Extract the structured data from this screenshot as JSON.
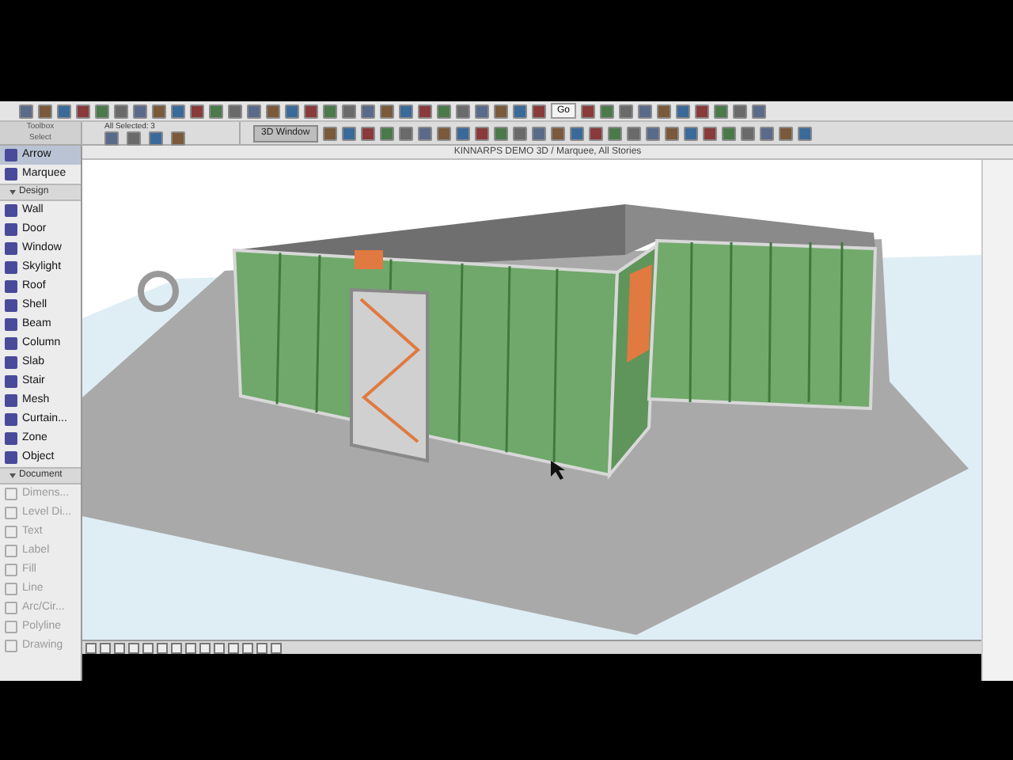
{
  "toolbar": {
    "go_label": "Go"
  },
  "info_box": {
    "selection": "All Selected: 3",
    "view_button": "3D Window"
  },
  "toolbox": {
    "title": "Toolbox",
    "select_label": "Select",
    "entries": [
      {
        "kind": "tool",
        "label": "Arrow",
        "selected": true,
        "disabled": false
      },
      {
        "kind": "tool",
        "label": "Marquee",
        "selected": false,
        "disabled": false
      },
      {
        "kind": "header",
        "label": "Design",
        "expanded": true
      },
      {
        "kind": "tool",
        "label": "Wall",
        "selected": false,
        "disabled": false
      },
      {
        "kind": "tool",
        "label": "Door",
        "selected": false,
        "disabled": false
      },
      {
        "kind": "tool",
        "label": "Window",
        "selected": false,
        "disabled": false
      },
      {
        "kind": "tool",
        "label": "Skylight",
        "selected": false,
        "disabled": false
      },
      {
        "kind": "tool",
        "label": "Roof",
        "selected": false,
        "disabled": false
      },
      {
        "kind": "tool",
        "label": "Shell",
        "selected": false,
        "disabled": false
      },
      {
        "kind": "tool",
        "label": "Beam",
        "selected": false,
        "disabled": false
      },
      {
        "kind": "tool",
        "label": "Column",
        "selected": false,
        "disabled": false
      },
      {
        "kind": "tool",
        "label": "Slab",
        "selected": false,
        "disabled": false
      },
      {
        "kind": "tool",
        "label": "Stair",
        "selected": false,
        "disabled": false
      },
      {
        "kind": "tool",
        "label": "Mesh",
        "selected": false,
        "disabled": false
      },
      {
        "kind": "tool",
        "label": "Curtain...",
        "selected": false,
        "disabled": false
      },
      {
        "kind": "tool",
        "label": "Zone",
        "selected": false,
        "disabled": false
      },
      {
        "kind": "tool",
        "label": "Object",
        "selected": false,
        "disabled": false
      },
      {
        "kind": "header",
        "label": "Document",
        "expanded": true
      },
      {
        "kind": "tool",
        "label": "Dimens...",
        "selected": false,
        "disabled": true
      },
      {
        "kind": "tool",
        "label": "Level Di...",
        "selected": false,
        "disabled": true
      },
      {
        "kind": "tool",
        "label": "Text",
        "selected": false,
        "disabled": true
      },
      {
        "kind": "tool",
        "label": "Label",
        "selected": false,
        "disabled": true
      },
      {
        "kind": "tool",
        "label": "Fill",
        "selected": false,
        "disabled": true
      },
      {
        "kind": "tool",
        "label": "Line",
        "selected": false,
        "disabled": true
      },
      {
        "kind": "tool",
        "label": "Arc/Cir...",
        "selected": false,
        "disabled": true
      },
      {
        "kind": "tool",
        "label": "Polyline",
        "selected": false,
        "disabled": true
      },
      {
        "kind": "tool",
        "label": "Drawing",
        "selected": false,
        "disabled": true
      }
    ]
  },
  "window": {
    "title": "KINNARPS DEMO 3D / Marquee, All Stories"
  }
}
